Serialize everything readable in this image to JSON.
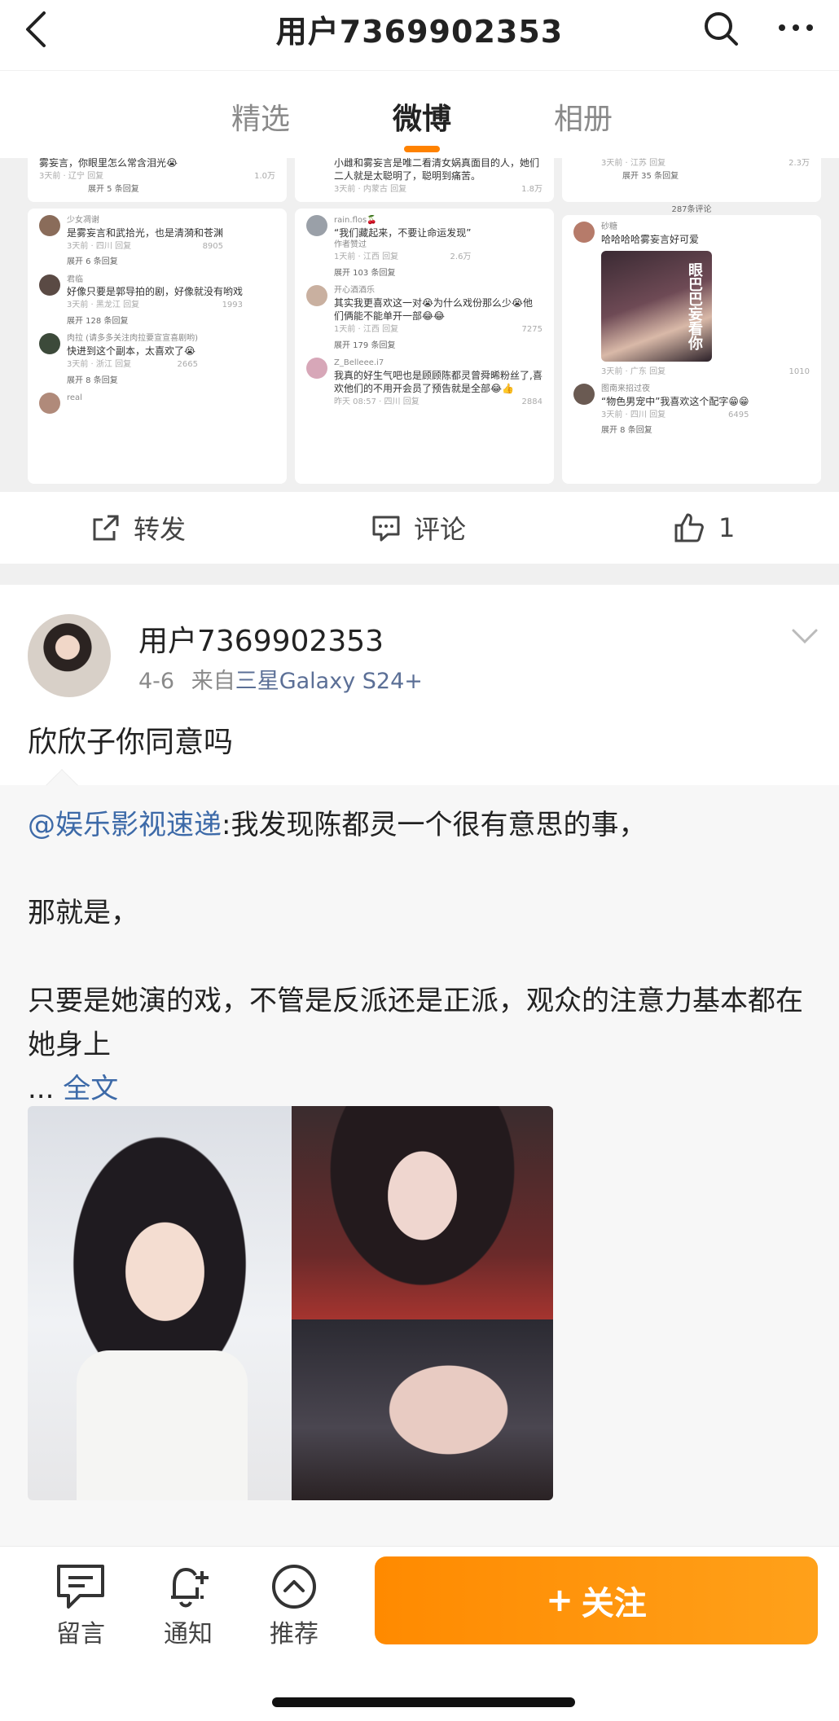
{
  "header": {
    "title": "用户7369902353"
  },
  "tabs": [
    {
      "label": "精选"
    },
    {
      "label": "微博"
    },
    {
      "label": "相册"
    }
  ],
  "colors": {
    "accent": "#ff8200",
    "link": "#3d6aa8",
    "source_link": "#5b6f96"
  },
  "collage": {
    "col1": [
      {
        "text": "雾妄言，你眼里怎么常含泪光😭",
        "meta": "3天前 · 辽宁  回复",
        "likes": "1.0万",
        "expand": "展开 5 条回复"
      },
      {
        "name": "少女凋谢",
        "text": "是雾妄言和武拾光，也是清漪和苍渊",
        "meta": "3天前 · 四川  回复",
        "likes": "8905",
        "expand": "展开 6 条回复"
      },
      {
        "name": "君临",
        "text": "好像只要是郭导拍的剧，好像就没有哟戏",
        "meta": "3天前 · 黑龙江  回复",
        "likes": "1993",
        "expand": "展开 128 条回复"
      },
      {
        "name": "肉拉 (请多多关注肉拉要宣宣喜剧哟)",
        "text": "快进到这个副本，太喜欢了😭",
        "meta": "3天前 · 浙江  回复",
        "likes": "2665",
        "expand": "展开 8 条回复"
      },
      {
        "name": "real"
      }
    ],
    "col2": [
      {
        "text": "小雌和雾妄言是唯二看清女娲真面目的人，她们二人就是太聪明了，聪明到痛苦。",
        "meta": "3天前 · 内蒙古  回复",
        "likes": "1.8万"
      },
      {
        "name": "rain.flos🍒",
        "text": "“我们藏起来，不要让命运发现”",
        "badge": "作者赞过",
        "meta": "1天前 · 江西  回复",
        "likes": "2.6万",
        "expand": "展开 103 条回复"
      },
      {
        "name": "开心酒酒乐",
        "text": "其实我更喜欢这一对😭为什么戏份那么少😭他们俩能不能单开一部😂😂",
        "meta": "1天前 · 江西  回复",
        "likes": "7275",
        "expand": "展开 179 条回复"
      },
      {
        "name": "Z_Belleee.i7",
        "text": "我真的好生气吧也是顾顾陈都灵曾舜晞粉丝了,喜欢他们的不用开会员了预告就是全部😂👍",
        "meta": "昨天 08:57 · 四川  回复",
        "likes": "2884"
      }
    ],
    "col3": [
      {
        "meta": "3天前 · 江苏  回复",
        "likes": "2.3万",
        "expand": "展开 35 条回复"
      },
      {
        "count": "287条评论"
      },
      {
        "name": "砂糖",
        "text": "哈哈哈哈雾妄言好可爱",
        "image_caption": "眼巴巴妄看你",
        "meta": "3天前 · 广东  回复",
        "likes": "1010"
      },
      {
        "name": "图南来招过夜",
        "text": "“物色男宠中”我喜欢这个配字😁😁",
        "meta": "3天前 · 四川  回复",
        "likes": "6495",
        "expand": "展开 8 条回复"
      }
    ]
  },
  "post1_actions": {
    "repost_label": "转发",
    "comment_label": "评论",
    "like_count": "1"
  },
  "post2": {
    "user": "用户7369902353",
    "date": "4-6",
    "from": "来自",
    "source": "三星Galaxy S24+",
    "text": "欣欣子你同意吗",
    "repost": {
      "mention": "@娱乐影视速递",
      "line1": ":我发现陈都灵一个很有意思的事，",
      "line2": "那就是，",
      "line3": "只要是她演的戏，不管是反派还是正派，观众的注意力基本都在她身上",
      "ellipsis": "...",
      "full_text": "全文"
    }
  },
  "bottom_bar": {
    "message_label": "留言",
    "notify_label": "通知",
    "recommend_label": "推荐",
    "follow_label": "关注",
    "follow_plus": "+"
  }
}
